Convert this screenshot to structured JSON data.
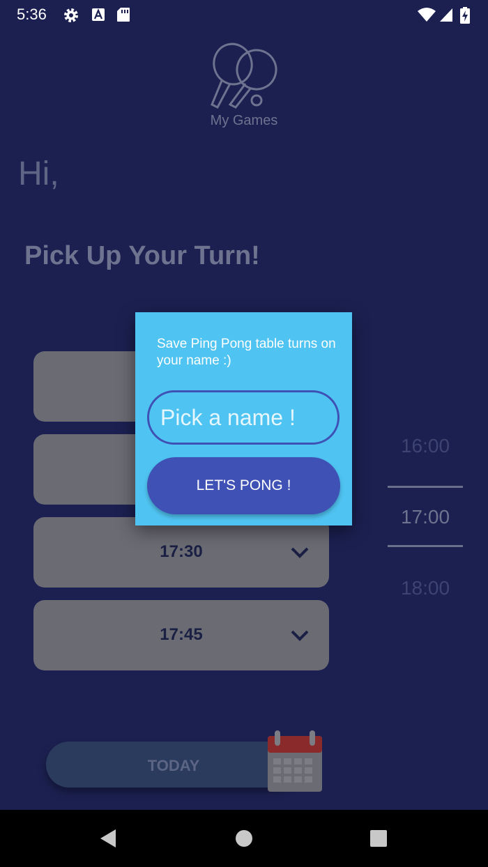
{
  "status_bar": {
    "time": "5:36",
    "icons": [
      "settings-icon",
      "a-notification-icon",
      "sd-card-icon",
      "wifi-icon",
      "cell-signal-icon",
      "battery-charging-icon"
    ]
  },
  "app": {
    "logo_icon": "ping-pong-paddles-icon",
    "name": "My Games"
  },
  "greeting": "Hi,",
  "headline": "Pick Up Your Turn!",
  "slots": [
    {
      "time": ""
    },
    {
      "time": ""
    },
    {
      "time": "17:30"
    },
    {
      "time": "17:45"
    }
  ],
  "hour_picker": {
    "above": "16:00",
    "selected": "17:00",
    "below": "18:00"
  },
  "bottom": {
    "today_label": "TODAY",
    "calendar_icon": "calendar-icon"
  },
  "dialog": {
    "message": "Save Ping Pong table turns on your name :)",
    "name_value": "",
    "name_placeholder": "Pick a name !",
    "submit_label": "LET'S PONG !"
  },
  "nav_bar": {
    "icons": [
      "back-icon",
      "home-icon",
      "recents-icon"
    ]
  },
  "colors": {
    "background": "#1b2050",
    "dialog": "#4fc3f1",
    "accent": "#3f51b5"
  }
}
